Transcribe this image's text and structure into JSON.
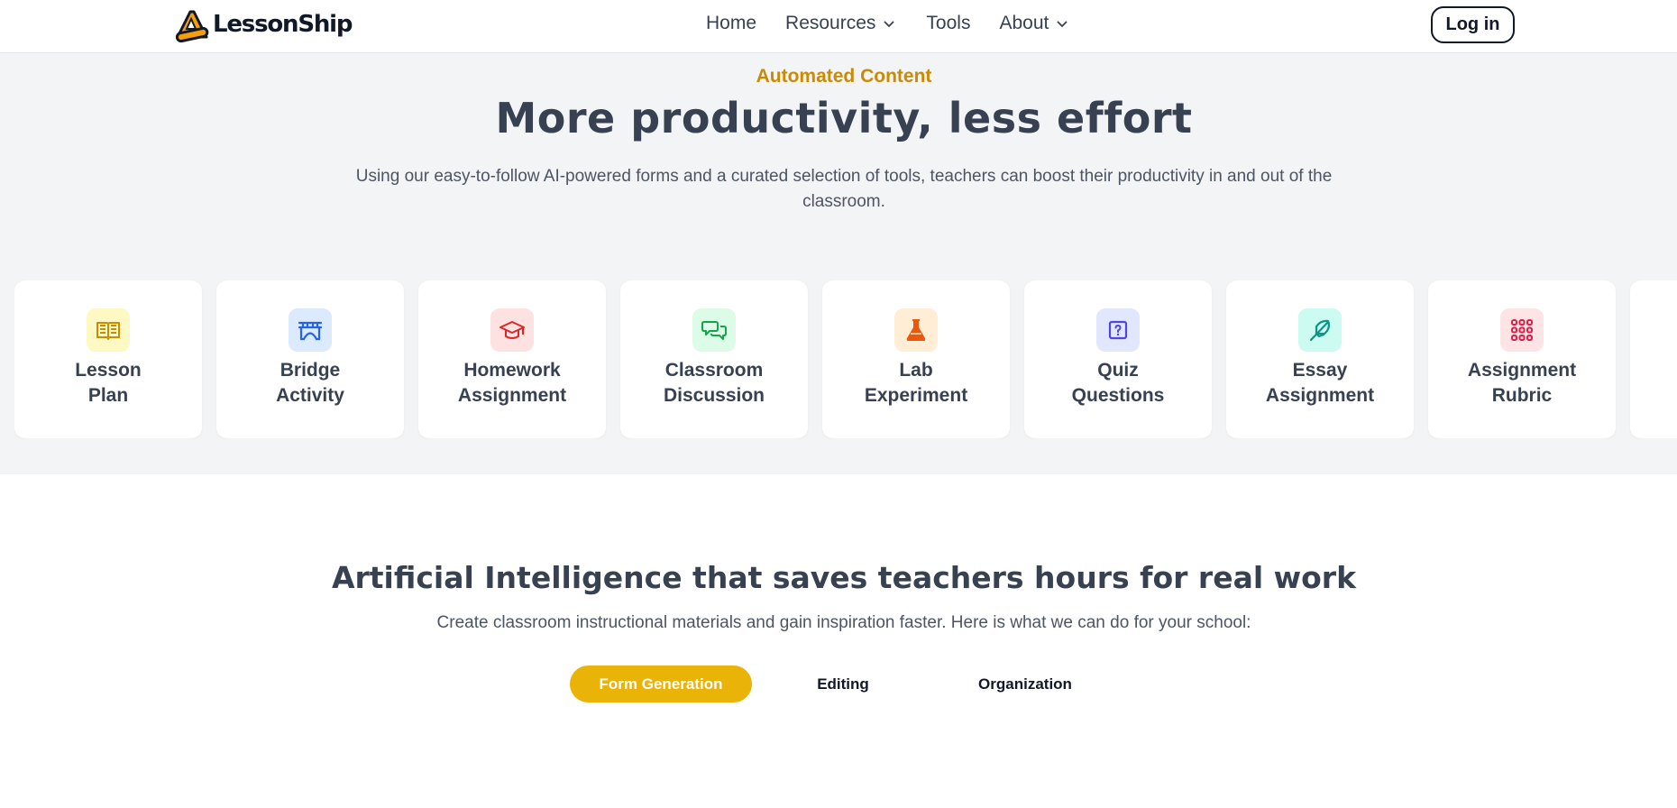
{
  "header": {
    "brand": "LessonShip",
    "nav": [
      {
        "label": "Home"
      },
      {
        "label": "Resources"
      },
      {
        "label": "Tools"
      },
      {
        "label": "About"
      }
    ],
    "login_label": "Log in"
  },
  "hero": {
    "eyebrow": "Automated Content",
    "title": "More productivity, less effort",
    "subtitle": "Using our easy-to-follow AI-powered forms and a curated selection of tools, teachers can boost their productivity in and out of the classroom."
  },
  "cards": [
    {
      "line1": "Lesson",
      "line2": "Plan",
      "icon": "book-icon",
      "icon_bg": "#fef9c3",
      "icon_color": "#ca8a04"
    },
    {
      "line1": "Bridge",
      "line2": "Activity",
      "icon": "bridge-icon",
      "icon_bg": "#dbeafe",
      "icon_color": "#2563eb"
    },
    {
      "line1": "Homework",
      "line2": "Assignment",
      "icon": "graduation-cap-icon",
      "icon_bg": "#fee2e2",
      "icon_color": "#dc2626"
    },
    {
      "line1": "Classroom",
      "line2": "Discussion",
      "icon": "chat-bubbles-icon",
      "icon_bg": "#dcfce7",
      "icon_color": "#16a34a"
    },
    {
      "line1": "Lab",
      "line2": "Experiment",
      "icon": "flask-icon",
      "icon_bg": "#ffedd5",
      "icon_color": "#ea580c"
    },
    {
      "line1": "Quiz",
      "line2": "Questions",
      "icon": "question-box-icon",
      "icon_bg": "#e0e7ff",
      "icon_color": "#4f46e5"
    },
    {
      "line1": "Essay",
      "line2": "Assignment",
      "icon": "feather-icon",
      "icon_bg": "#ccfbf1",
      "icon_color": "#0d9488"
    },
    {
      "line1": "Assignment",
      "line2": "Rubric",
      "icon": "grid-dots-icon",
      "icon_bg": "#ffe4e6",
      "icon_color": "#e11d48"
    }
  ],
  "features": {
    "title": "Artificial Intelligence that saves teachers hours for real work",
    "subtitle": "Create classroom instructional materials and gain inspiration faster. Here is what we can do for your school:",
    "tabs": [
      {
        "label": "Form Generation",
        "active": true
      },
      {
        "label": "Editing",
        "active": false
      },
      {
        "label": "Organization",
        "active": false
      }
    ]
  },
  "colors": {
    "accent": "#eab308",
    "eyebrow": "#ca8a04",
    "section_bg": "#f3f4f6"
  }
}
